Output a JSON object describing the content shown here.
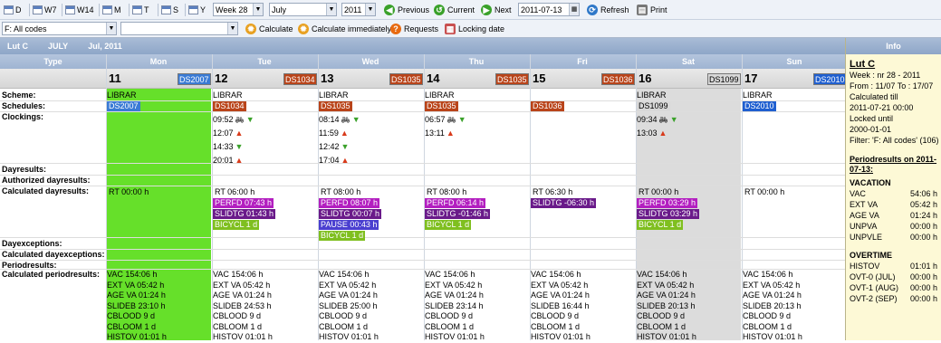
{
  "toolbar": {
    "views": [
      {
        "label": "D"
      },
      {
        "label": "W7"
      },
      {
        "label": "W14"
      },
      {
        "label": "M"
      },
      {
        "label": "T"
      },
      {
        "label": "S"
      },
      {
        "label": "Y"
      }
    ],
    "week_select": "Week 28",
    "month_select": "July",
    "year_select": "2011",
    "previous_label": "Previous",
    "current_label": "Current",
    "next_label": "Next",
    "date_value": "2011-07-13",
    "refresh_label": "Refresh",
    "print_label": "Print"
  },
  "toolbar2": {
    "filter_select": "F: All codes",
    "second_select": "",
    "calculate_label": "Calculate",
    "calculate_immediately_label": "Calculate immediately",
    "requests_label": "Requests",
    "locking_date_label": "Locking date"
  },
  "header": {
    "person": "Lut C",
    "month": "JULY",
    "period": "Jul, 2011"
  },
  "columns": {
    "type_label": "Type"
  },
  "days": [
    {
      "name": "Mon",
      "num": "11",
      "code": "DS2007",
      "code_color": "#3a7bd5"
    },
    {
      "name": "Tue",
      "num": "12",
      "code": "DS1034",
      "code_color": "#b9441a"
    },
    {
      "name": "Wed",
      "num": "13",
      "code": "DS1035",
      "code_color": "#b9441a"
    },
    {
      "name": "Thu",
      "num": "14",
      "code": "DS1035",
      "code_color": "#b9441a"
    },
    {
      "name": "Fri",
      "num": "15",
      "code": "DS1036",
      "code_color": "#b9441a"
    },
    {
      "name": "Sat",
      "num": "16",
      "code": "DS1099",
      "code_color": "#d8d8d8"
    },
    {
      "name": "Sun",
      "num": "17",
      "code": "DS2010",
      "code_color": "#1f5fd0"
    }
  ],
  "row_labels": {
    "scheme": "Scheme:",
    "schedules": "Schedules:",
    "clockings": "Clockings:",
    "dayresults": "Dayresults:",
    "authorized": "Authorized dayresults:",
    "calculated": "Calculated dayresults:",
    "dayexceptions": "Dayexceptions:",
    "calc_dayexceptions": "Calculated dayexceptions:",
    "periodresults": "Periodresults:",
    "calc_periodresults": "Calculated periodresults:"
  },
  "schemes": [
    "LIBRAR",
    "LIBRAR",
    "LIBRAR",
    "LIBRAR",
    "",
    "LIBRAR",
    "LIBRAR"
  ],
  "schedules": [
    "DS2007",
    "DS1034",
    "DS1035",
    "DS1035",
    "DS1036",
    "DS1099",
    "DS2010"
  ],
  "clockings": {
    "tue": [
      {
        "time": "09:52",
        "bike": true,
        "dir": "down"
      },
      {
        "time": "12:07",
        "bike": false,
        "dir": "up"
      },
      {
        "time": "14:33",
        "bike": false,
        "dir": "down"
      },
      {
        "time": "20:01",
        "bike": false,
        "dir": "up"
      }
    ],
    "wed": [
      {
        "time": "08:14",
        "bike": true,
        "dir": "down"
      },
      {
        "time": "11:59",
        "bike": false,
        "dir": "up"
      },
      {
        "time": "12:42",
        "bike": false,
        "dir": "down"
      },
      {
        "time": "17:04",
        "bike": false,
        "dir": "up"
      }
    ],
    "thu": [
      {
        "time": "06:57",
        "bike": true,
        "dir": "down"
      },
      {
        "time": "13:11",
        "bike": false,
        "dir": "up"
      }
    ],
    "sat": [
      {
        "time": "09:34",
        "bike": true,
        "dir": "down"
      },
      {
        "time": "13:03",
        "bike": false,
        "dir": "up"
      }
    ]
  },
  "calc_dayresults": [
    [
      {
        "text": "RT 00:00 h",
        "color": ""
      }
    ],
    [
      {
        "text": "RT 06:00 h",
        "color": ""
      },
      {
        "text": "PERFD 07:43 h",
        "color": "#b31fc0"
      },
      {
        "text": "SLIDTG 01:43 h",
        "color": "#6a1a8a"
      },
      {
        "text": "BICYCL 1 d",
        "color": "#7fbf1f"
      }
    ],
    [
      {
        "text": "RT 08:00 h",
        "color": ""
      },
      {
        "text": "PERFD 08:07 h",
        "color": "#b31fc0"
      },
      {
        "text": "SLIDTG 00:07 h",
        "color": "#6a1a8a"
      },
      {
        "text": "PAUSE 00:43 h",
        "color": "#4a3fd0"
      },
      {
        "text": "BICYCL 1 d",
        "color": "#7fbf1f"
      }
    ],
    [
      {
        "text": "RT 08:00 h",
        "color": ""
      },
      {
        "text": "PERFD 06:14 h",
        "color": "#b31fc0"
      },
      {
        "text": "SLIDTG -01:46 h",
        "color": "#6a1a8a"
      },
      {
        "text": "BICYCL 1 d",
        "color": "#7fbf1f"
      }
    ],
    [
      {
        "text": "RT 06:30 h",
        "color": ""
      },
      {
        "text": "SLIDTG -06:30 h",
        "color": "#6a1a8a"
      }
    ],
    [
      {
        "text": "RT 00:00 h",
        "color": ""
      },
      {
        "text": "PERFD 03:29 h",
        "color": "#b31fc0"
      },
      {
        "text": "SLIDTG 03:29 h",
        "color": "#6a1a8a"
      },
      {
        "text": "BICYCL 1 d",
        "color": "#7fbf1f"
      }
    ],
    [
      {
        "text": "RT 00:00 h",
        "color": ""
      }
    ]
  ],
  "periodresults": [
    [
      "VAC 154:06 h",
      "EXT VA 05:42 h",
      "AGE VA 01:24 h",
      "SLIDEB 23:10 h",
      "CBLOOD 9 d",
      "CBLOOM 1 d",
      "HISTOV 01:01 h"
    ],
    [
      "VAC 154:06 h",
      "EXT VA 05:42 h",
      "AGE VA 01:24 h",
      "SLIDEB 24:53 h",
      "CBLOOD 9 d",
      "CBLOOM 1 d",
      "HISTOV 01:01 h"
    ],
    [
      "VAC 154:06 h",
      "EXT VA 05:42 h",
      "AGE VA 01:24 h",
      "SLIDEB 25:00 h",
      "CBLOOD 9 d",
      "CBLOOM 1 d",
      "HISTOV 01:01 h"
    ],
    [
      "VAC 154:06 h",
      "EXT VA 05:42 h",
      "AGE VA 01:24 h",
      "SLIDEB 23:14 h",
      "CBLOOD 9 d",
      "CBLOOM 1 d",
      "HISTOV 01:01 h"
    ],
    [
      "VAC 154:06 h",
      "EXT VA 05:42 h",
      "AGE VA 01:24 h",
      "SLIDEB 16:44 h",
      "CBLOOD 9 d",
      "CBLOOM 1 d",
      "HISTOV 01:01 h"
    ],
    [
      "VAC 154:06 h",
      "EXT VA 05:42 h",
      "AGE VA 01:24 h",
      "SLIDEB 20:13 h",
      "CBLOOD 9 d",
      "CBLOOM 1 d",
      "HISTOV 01:01 h"
    ],
    [
      "VAC 154:06 h",
      "EXT VA 05:42 h",
      "AGE VA 01:24 h",
      "SLIDEB 20:13 h",
      "CBLOOD 9 d",
      "CBLOOM 1 d",
      "HISTOV 01:01 h"
    ]
  ],
  "info": {
    "title": "Info",
    "name": "Lut C",
    "week": "Week : nr 28 - 2011",
    "from": "From : 11/07 To : 17/07",
    "calc_till_label": "Calculated till",
    "calc_till": "2011-07-21 00:00",
    "locked_label": "Locked until",
    "locked": "2000-01-01",
    "filter": "Filter: 'F: All codes' (106)",
    "periodresults_title": "Periodresults on 2011-07-13:",
    "vacation_title": "VACATION",
    "vacation": [
      {
        "k": "VAC",
        "v": "54:06 h"
      },
      {
        "k": "EXT VA",
        "v": "05:42 h"
      },
      {
        "k": "AGE VA",
        "v": "01:24 h"
      },
      {
        "k": "UNPVA",
        "v": "00:00 h"
      },
      {
        "k": "UNPVLE",
        "v": "00:00 h"
      }
    ],
    "overtime_title": "OVERTIME",
    "overtime": [
      {
        "k": "HISTOV",
        "v": "01:01 h"
      },
      {
        "k": "OVT-0 (JUL)",
        "v": "00:00 h"
      },
      {
        "k": "OVT-1 (AUG)",
        "v": "00:00 h"
      },
      {
        "k": "OVT-2 (SEP)",
        "v": "00:00 h"
      }
    ]
  },
  "colors": {
    "monday_green": "#66e02a",
    "weekend_grey": "#dcdcdc",
    "header_blue": "#8ea6c8",
    "info_bg": "#fdf9d6"
  }
}
